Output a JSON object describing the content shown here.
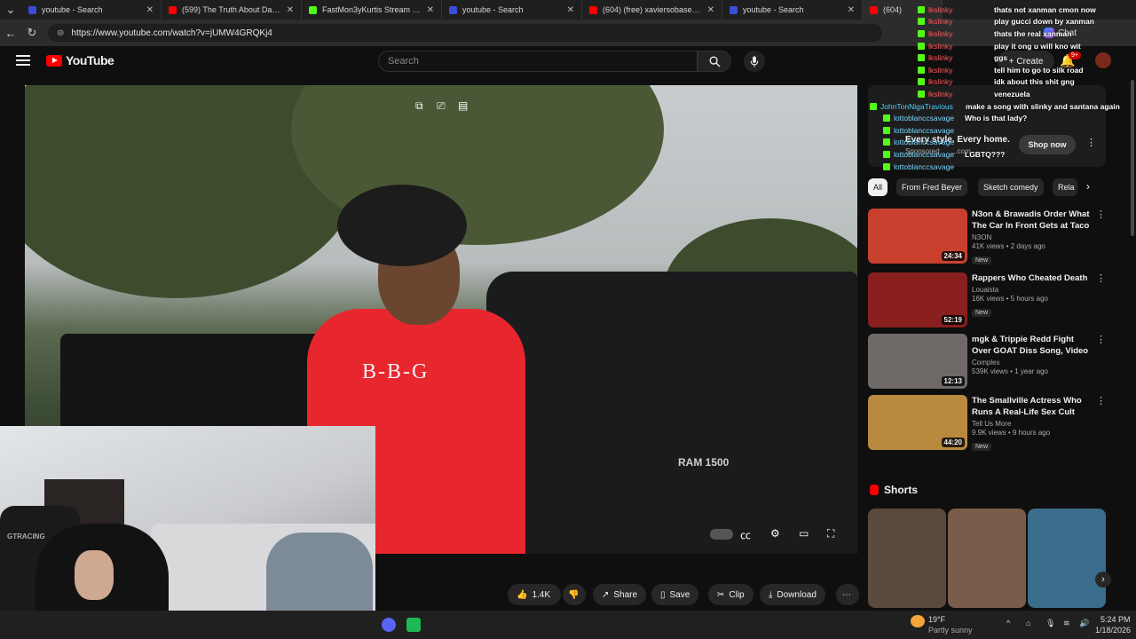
{
  "tabs": [
    {
      "title": "youtube - Search",
      "fav": "#3c4cdb"
    },
    {
      "title": "(599) The Truth About Dark Web D",
      "fav": "#ff0000"
    },
    {
      "title": "FastMon3yKurtis Stream - Watch L",
      "fav": "#53fc18"
    },
    {
      "title": "youtube - Search",
      "fav": "#3c4cdb"
    },
    {
      "title": "(604) (free) xaviersobased + ksuu",
      "fav": "#ff0000"
    },
    {
      "title": "youtube - Search",
      "fav": "#3c4cdb"
    },
    {
      "title": "(604)",
      "fav": "#ff0000"
    }
  ],
  "address": {
    "url": "https://www.youtube.com/watch?v=jUMW4GRQKj4"
  },
  "header": {
    "logo": "YouTube",
    "search_placeholder": "Search",
    "create_label": "Create",
    "notification_count": "9+",
    "browser_chat_label": "Chat"
  },
  "video": {
    "shirt_text": "B-B-G",
    "truck_badge": "RAM 1500"
  },
  "webcam": {
    "brand": "GTRACING"
  },
  "actions": {
    "likes": "1.4K",
    "share": "Share",
    "save": "Save",
    "clip": "Clip",
    "download": "Download"
  },
  "ad": {
    "headline": "Every style. Every home.",
    "sponsored": "Sponsored",
    "domain": "...com",
    "cta": "Shop now"
  },
  "chips": [
    "All",
    "From Fred Beyer",
    "Sketch comedy",
    "Rela"
  ],
  "recommendations": [
    {
      "title": "N3on & Brawadis Order What The Car In Front Gets at Taco ...",
      "channel": "N3ON",
      "meta": "41K views • 2 days ago",
      "badge": "New",
      "duration": "24:34",
      "thumb": "#c9412e"
    },
    {
      "title": "Rappers Who Cheated Death",
      "channel": "Louaista",
      "meta": "16K views • 5 hours ago",
      "badge": "New",
      "duration": "52:19",
      "thumb": "#8a1f1f"
    },
    {
      "title": "mgk & Trippie Redd Fight Over GOAT Diss Song, Video Game, ...",
      "channel": "Complex",
      "meta": "539K views • 1 year ago",
      "badge": "",
      "duration": "12:13",
      "thumb": "#6f6a68"
    },
    {
      "title": "The Smallville Actress Who Runs A Real-Life Sex Cult",
      "channel": "Tell Us More",
      "meta": "9.9K views • 9 hours ago",
      "badge": "New",
      "duration": "44:20",
      "thumb": "#b98a3e"
    }
  ],
  "shorts": {
    "title": "Shorts",
    "thumbs": [
      "#5a4a3d",
      "#7a5c4a",
      "#3b6e8c"
    ]
  },
  "chat": [
    {
      "user": "lkslinky",
      "text": "thats not xanman cmon now"
    },
    {
      "user": "lkslinky",
      "text": "play gucci down by xanman"
    },
    {
      "user": "lkslinky",
      "text": "thats the real xanman"
    },
    {
      "user": "lkslinky",
      "text": "play it ong u will kno wit"
    },
    {
      "user": "lkslinky",
      "text": "ggs"
    },
    {
      "user": "lkslinky",
      "text": "tell him to go to silk road"
    },
    {
      "user": "lkslinky",
      "text": "idk about this shit gng"
    },
    {
      "user": "lkslinky",
      "text": "venezuela"
    },
    {
      "user": "JohnTonNigaTravious",
      "text": "make a song with slinky and santana again"
    },
    {
      "user": "lottoblanccsavage",
      "text": "Who is that lady?"
    },
    {
      "user": "lottoblanccsavage",
      "text": ""
    },
    {
      "user": "lottoblanccsavage",
      "text": ""
    },
    {
      "user": "lottoblanccsavage",
      "text": "LGBTQ???"
    },
    {
      "user": "lottoblanccsavage",
      "text": ""
    }
  ],
  "taskbar": {
    "temp": "19°F",
    "weather": "Partly sunny",
    "time": "5:24 PM",
    "date": "1/18/2026"
  }
}
